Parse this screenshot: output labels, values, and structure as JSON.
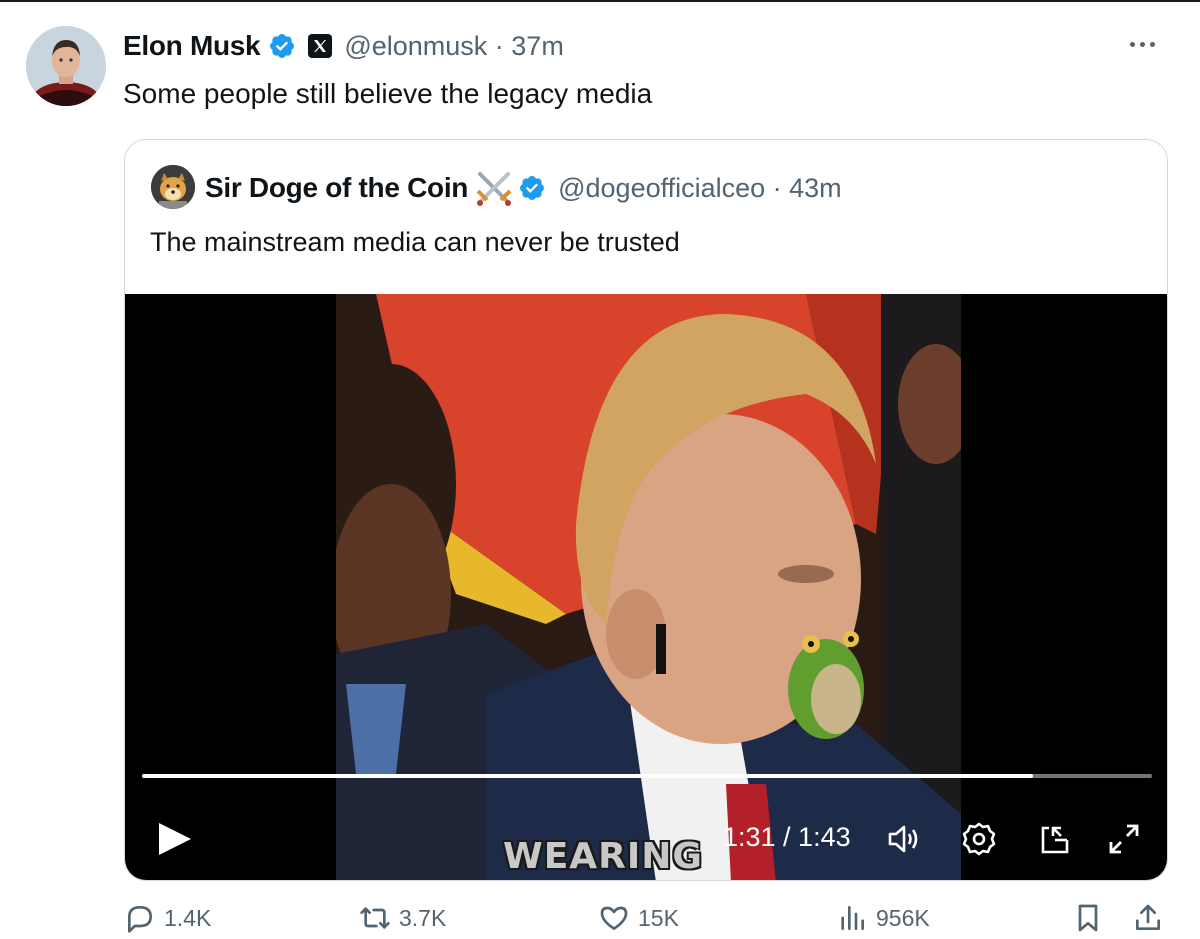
{
  "tweet": {
    "author_name": "Elon Musk",
    "handle_time": "@elonmusk · 37m",
    "text": "Some people still believe the legacy media",
    "avatar_icon": "profile-avatar",
    "verified_color": "#1d9bf0"
  },
  "quote": {
    "author_name": "Sir Doge of the Coin",
    "handle_time": "@dogeofficialceo · 43m",
    "text": "The mainstream media can never be trusted",
    "avatar_icon": "doge-avatar",
    "emoji_icon": "crossed-swords-icon"
  },
  "video": {
    "caption": "WEARING",
    "time": "1:31 / 1:43",
    "progress": 0.882,
    "controls": [
      "play-icon",
      "volume-icon",
      "settings-icon",
      "pip-icon",
      "fullscreen-icon"
    ]
  },
  "actions": {
    "replies": "1.4K",
    "reposts": "3.7K",
    "likes": "15K",
    "views": "956K"
  }
}
